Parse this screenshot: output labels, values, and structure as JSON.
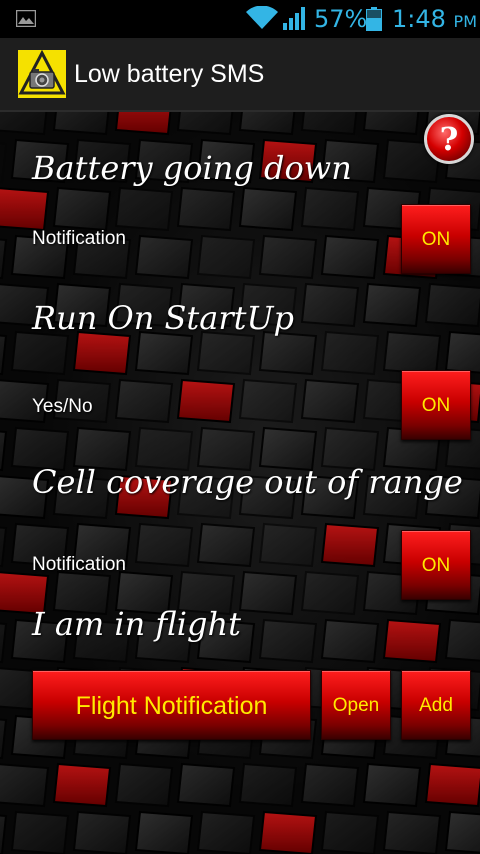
{
  "status_bar": {
    "battery_percent": "57%",
    "time": "1:48",
    "ampm": "PM",
    "icons": [
      "image-notification-icon",
      "wifi-icon",
      "cell-signal-icon",
      "battery-icon"
    ],
    "accent_color": "#33b5e5"
  },
  "action_bar": {
    "title": "Low battery SMS",
    "icon": "app-warning-icon"
  },
  "help": {
    "label": "?"
  },
  "sections": [
    {
      "title": "Battery going down",
      "label": "Notification",
      "toggle": "ON"
    },
    {
      "title": "Run On StartUp",
      "label": "Yes/No",
      "toggle": "ON"
    },
    {
      "title": "Cell coverage out of range",
      "label": "Notification",
      "toggle": "ON"
    },
    {
      "title": "I am in flight"
    }
  ],
  "flight": {
    "notification_label": "Flight Notification",
    "open_label": "Open",
    "add_label": "Add"
  },
  "colors": {
    "button_red": "#c90000",
    "button_text": "#ffea00",
    "title_text": "#ffffff"
  }
}
